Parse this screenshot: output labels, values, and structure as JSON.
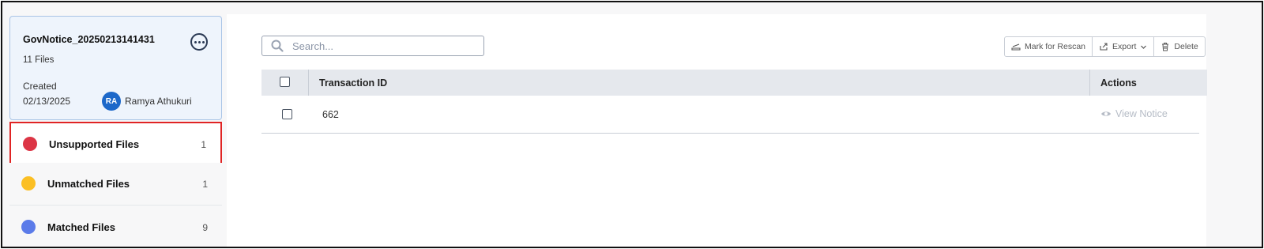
{
  "batch": {
    "title": "GovNotice_20250213141431",
    "files": "11 Files",
    "created_label": "Created",
    "created_date": "02/13/2025",
    "user_initials": "RA",
    "user_name": "Ramya Athukuri"
  },
  "categories": [
    {
      "label": "Unsupported Files",
      "count": "1",
      "color": "#dc3545"
    },
    {
      "label": "Unmatched Files",
      "count": "1",
      "color": "#fbbf24"
    },
    {
      "label": "Matched Files",
      "count": "9",
      "color": "#5b7be9"
    }
  ],
  "search": {
    "placeholder": "Search..."
  },
  "toolbar": {
    "rescan_label": "Mark for Rescan",
    "export_label": "Export",
    "delete_label": "Delete"
  },
  "table": {
    "headers": {
      "transaction_id": "Transaction ID",
      "actions": "Actions"
    },
    "rows": [
      {
        "transaction_id": "662",
        "action_label": "View Notice"
      }
    ]
  }
}
